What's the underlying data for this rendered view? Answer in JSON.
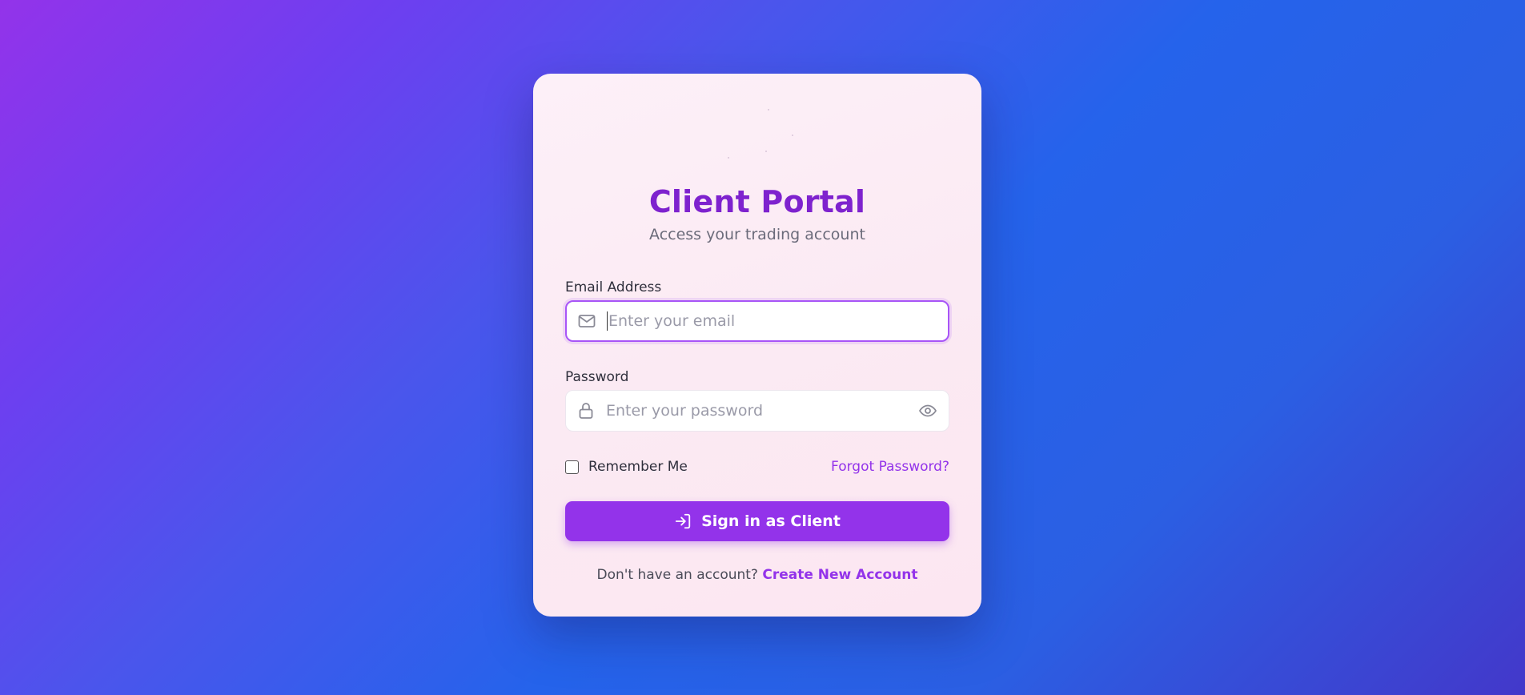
{
  "header": {
    "title": "Client Portal",
    "subtitle": "Access your trading account"
  },
  "email": {
    "label": "Email Address",
    "placeholder": "Enter your email",
    "value": "",
    "icon": "mail-icon"
  },
  "password": {
    "label": "Password",
    "placeholder": "Enter your password",
    "value": "",
    "icon": "lock-icon",
    "toggle_icon": "eye-icon"
  },
  "options": {
    "remember_label": "Remember Me",
    "remember_checked": false,
    "forgot_label": "Forgot Password?"
  },
  "submit": {
    "label": "Sign in as Client",
    "icon": "log-in-icon"
  },
  "footer": {
    "prompt": "Don't have an account?",
    "link_label": "Create New Account"
  },
  "colors": {
    "accent": "#9333ea",
    "title": "#7e22ce",
    "background_start": "#9333ea",
    "background_mid": "#2563eb",
    "background_end": "#4338ca"
  }
}
